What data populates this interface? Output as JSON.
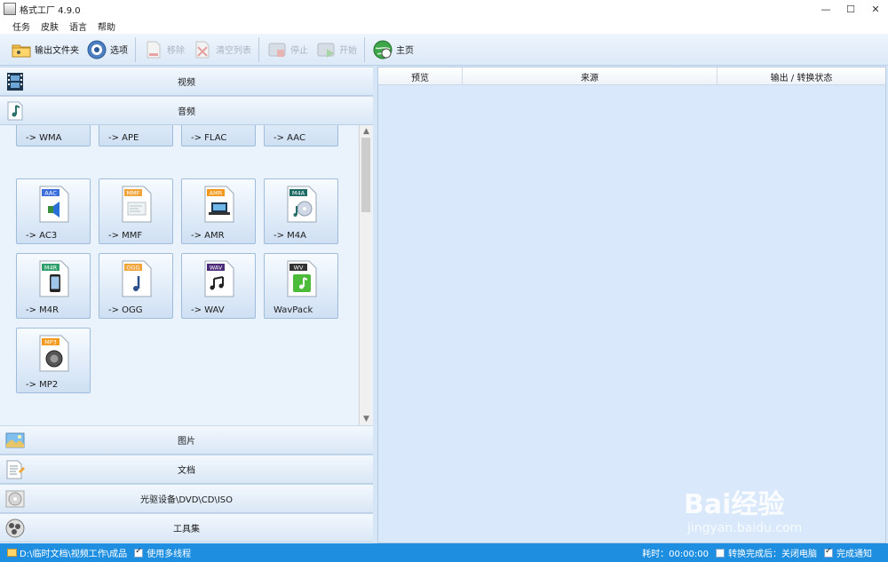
{
  "window": {
    "title": "格式工厂 4.9.0",
    "minimize": "—",
    "maximize": "☐",
    "close": "✕"
  },
  "menu": [
    "任务",
    "皮肤",
    "语言",
    "帮助"
  ],
  "toolbar": {
    "output_folder": "输出文件夹",
    "options": "选项",
    "remove": "移除",
    "clear_list": "清空列表",
    "stop": "停止",
    "start": "开始",
    "home": "主页"
  },
  "categories": {
    "video": "视频",
    "audio": "音频",
    "image": "图片",
    "document": "文档",
    "rom": "光驱设备\\DVD\\CD\\ISO",
    "tools": "工具集"
  },
  "formats": [
    {
      "label": "-> WMA",
      "badge": "",
      "color": "#2a6fd6",
      "icon": "play-icon"
    },
    {
      "label": "-> APE",
      "badge": "",
      "color": "#444444",
      "icon": "ape-icon"
    },
    {
      "label": "-> FLAC",
      "badge": "",
      "color": "#222222",
      "icon": "headphones-icon"
    },
    {
      "label": "-> AAC",
      "badge": "",
      "color": "#2a6fd6",
      "icon": "speaker-icon"
    },
    {
      "label": "-> AC3",
      "badge": "AAC",
      "color": "#3d6fdc",
      "icon": "speaker-icon"
    },
    {
      "label": "-> MMF",
      "badge": "MMF",
      "color": "#f0a43a",
      "icon": "mobile-doc-icon"
    },
    {
      "label": "-> AMR",
      "badge": "AMR",
      "color": "#f39a1e",
      "icon": "laptop-icon"
    },
    {
      "label": "-> M4A",
      "badge": "M4A",
      "color": "#1e6b66",
      "icon": "disc-icon"
    },
    {
      "label": "-> M4R",
      "badge": "M4R",
      "color": "#2fa06b",
      "icon": "phone-icon"
    },
    {
      "label": "-> OGG",
      "badge": "OGG",
      "color": "#f0a43a",
      "icon": "music-note-icon"
    },
    {
      "label": "-> WAV",
      "badge": "WAV",
      "color": "#4c2a7a",
      "icon": "music-notes-icon"
    },
    {
      "label": "WavPack",
      "badge": "WV",
      "color": "#333333",
      "icon": "green-note-icon"
    },
    {
      "label": "-> MP2",
      "badge": "MP3",
      "color": "#f39a1e",
      "icon": "speaker-cone-icon"
    }
  ],
  "table": {
    "columns": [
      "预览",
      "来源",
      "输出 / 转换状态"
    ]
  },
  "status": {
    "path": "D:\\临时文档\\视频工作\\成品",
    "multithread": "使用多线程",
    "elapsed": "耗时：00:00:00",
    "after_done": "转换完成后：关闭电脑",
    "notify": "完成通知"
  },
  "watermark": {
    "brand": "Bai经验",
    "url": "jingyan.baidu.com"
  }
}
